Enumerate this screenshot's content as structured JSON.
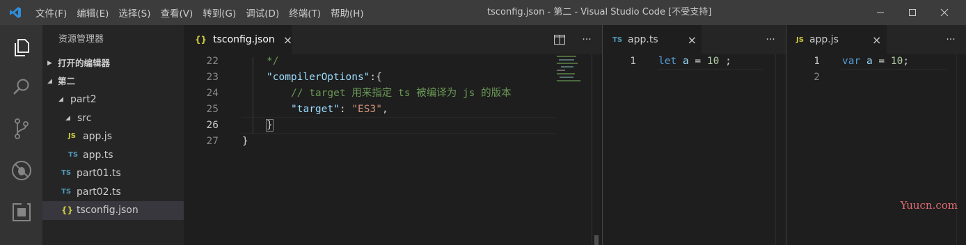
{
  "titlebar": {
    "menu": [
      "文件(F)",
      "编辑(E)",
      "选择(S)",
      "查看(V)",
      "转到(G)",
      "调试(D)",
      "终端(T)",
      "帮助(H)"
    ],
    "window_title": "tsconfig.json - 第二 - Visual Studio Code [不受支持]"
  },
  "activitybar": {
    "icons": [
      "files-icon",
      "search-icon",
      "source-control-icon",
      "debug-icon",
      "extensions-icon"
    ]
  },
  "sidebar": {
    "title": "资源管理器",
    "open_editors_label": "打开的编辑器",
    "folder_label": "第二",
    "tree": [
      {
        "label": "part2",
        "type": "folder"
      },
      {
        "label": "src",
        "type": "folder"
      },
      {
        "label": "app.js",
        "type": "js",
        "icon_text": "JS"
      },
      {
        "label": "app.ts",
        "type": "ts",
        "icon_text": "TS"
      },
      {
        "label": "part01.ts",
        "type": "ts",
        "icon_text": "TS"
      },
      {
        "label": "part02.ts",
        "type": "ts",
        "icon_text": "TS"
      },
      {
        "label": "tsconfig.json",
        "type": "json",
        "icon_text": "{}"
      }
    ]
  },
  "editor1": {
    "tab_label": "tsconfig.json",
    "tab_icon": "{}",
    "lines": [
      "22",
      "23",
      "24",
      "25",
      "26",
      "27"
    ],
    "code": {
      "l22": "*/",
      "l23_key": "\"compilerOptions\"",
      "l23_rest": ":{",
      "l24": "// target 用来指定 ts 被编译为 js 的版本",
      "l25_key": "\"target\"",
      "l25_colon": ": ",
      "l25_val": "\"ES3\"",
      "l25_comma": ",",
      "l26": "}",
      "l27": "}"
    }
  },
  "editor2": {
    "tab_label": "app.ts",
    "tab_icon": "TS",
    "lines": [
      "1"
    ],
    "code": {
      "kw": "let",
      "var": "a",
      "op": " = ",
      "num": "10",
      "end": " ;"
    }
  },
  "editor3": {
    "tab_label": "app.js",
    "tab_icon": "JS",
    "lines": [
      "1",
      "2"
    ],
    "code": {
      "kw": "var",
      "var": "a",
      "op": " = ",
      "num": "10",
      "end": ";"
    }
  },
  "tab_actions": {
    "split": "⧉",
    "more": "···",
    "close": "×"
  },
  "watermark": "Yuucn.com",
  "colors": {
    "accent": "#007acc",
    "ts": "#519aba",
    "js": "#cbcb41"
  }
}
